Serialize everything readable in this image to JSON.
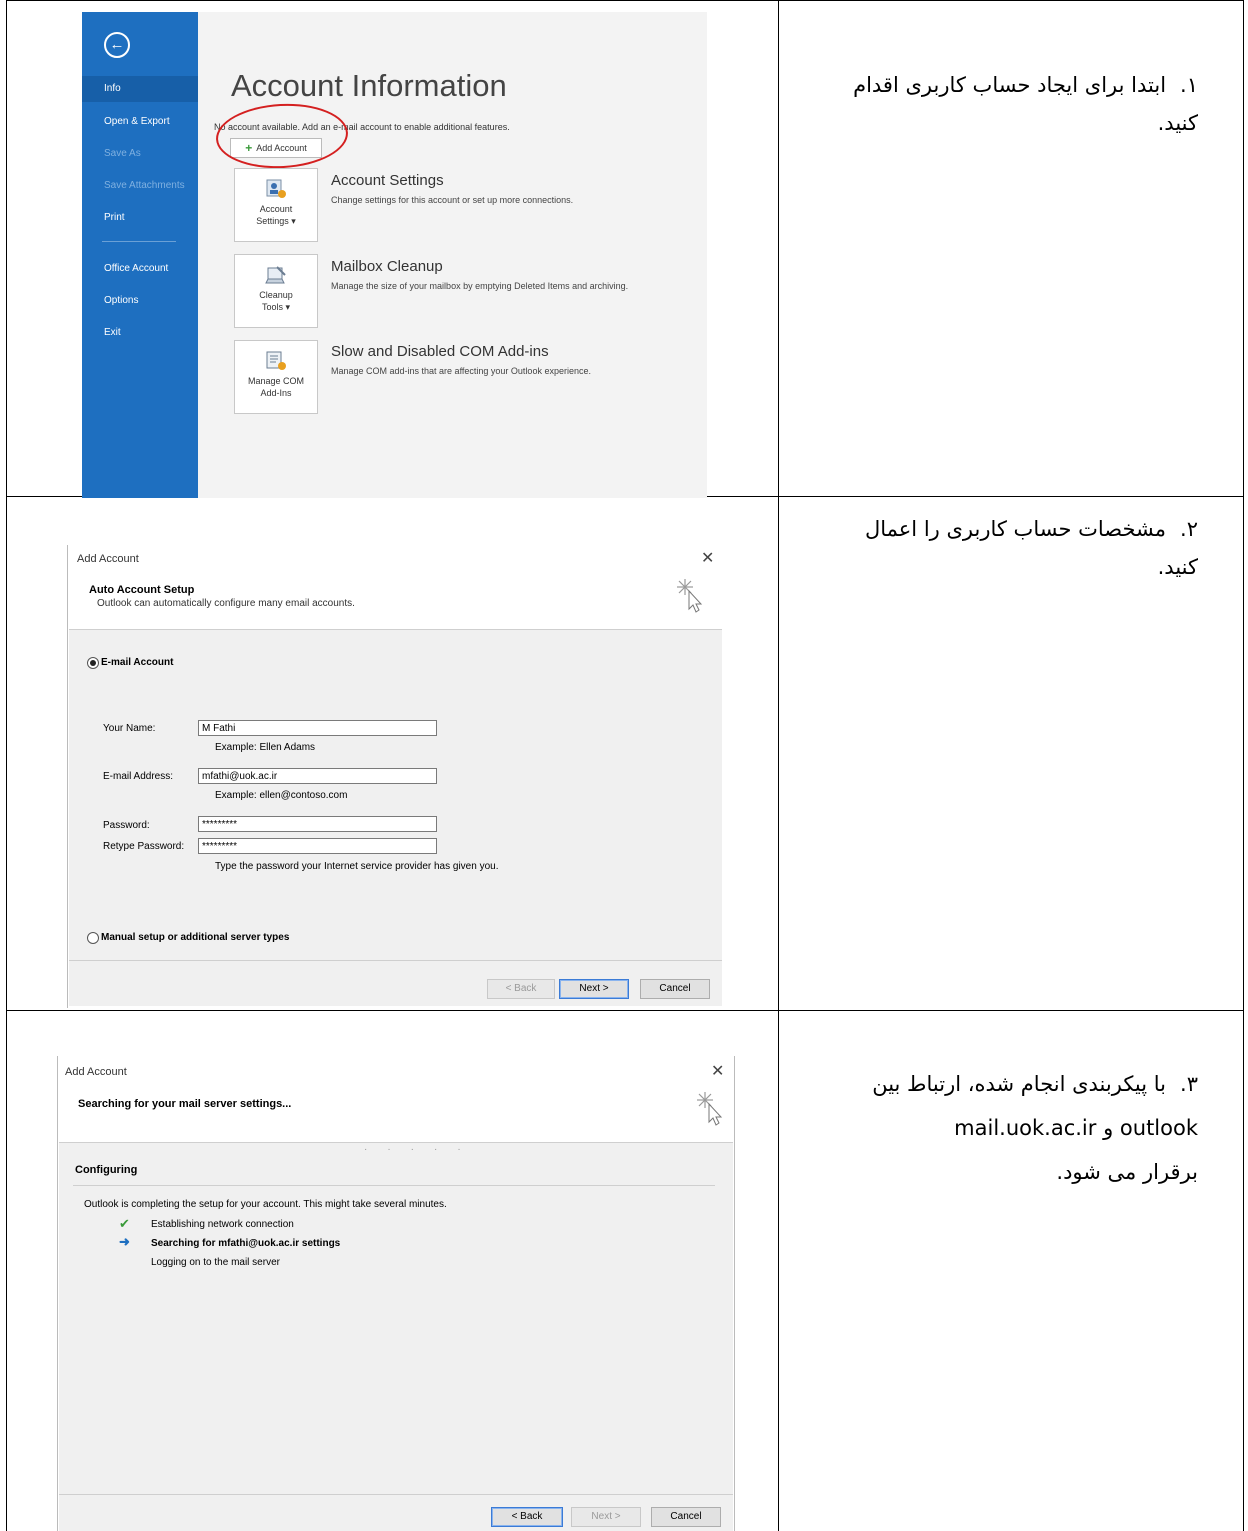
{
  "steps": [
    {
      "number": "۱.",
      "text_line1": "ابتدا برای ایجاد حساب کاربری اقدام",
      "text_line2": "کنید."
    },
    {
      "number": "۲.",
      "text_line1": "مشخصات حساب کاربری را اعمال",
      "text_line2": "کنید."
    },
    {
      "number": "۳.",
      "text_line1": "با پیکربندی انجام شده، ارتباط بین",
      "text_line2": "outlook و mail.uok.ac.ir",
      "text_line3": "برقرار می شود."
    }
  ],
  "backstage": {
    "back_icon": "back-arrow-icon",
    "sidebar": {
      "info": "Info",
      "open_export": "Open & Export",
      "save_as": "Save As",
      "save_attachments": "Save Attachments",
      "print": "Print",
      "office_account": "Office Account",
      "options": "Options",
      "exit": "Exit"
    },
    "title": "Account Information",
    "no_account_text": "No account available. Add an e-mail account to enable additional features.",
    "add_account_label": "Add Account",
    "sections": [
      {
        "tile_label_1": "Account",
        "tile_label_2": "Settings ▾",
        "title": "Account Settings",
        "desc": "Change settings for this account or set up more connections.",
        "icon": "account-settings-icon"
      },
      {
        "tile_label_1": "Cleanup",
        "tile_label_2": "Tools ▾",
        "title": "Mailbox Cleanup",
        "desc": "Manage the size of your mailbox by emptying Deleted Items and archiving.",
        "icon": "cleanup-tools-icon"
      },
      {
        "tile_label_1": "Manage COM",
        "tile_label_2": "Add-Ins",
        "title": "Slow and Disabled COM Add-ins",
        "desc": "Manage COM add-ins that are affecting your Outlook experience.",
        "icon": "com-addins-icon"
      }
    ],
    "colors": {
      "sidebar": "#1e6fc0",
      "highlight_circle": "#d42020"
    }
  },
  "dialog_setup": {
    "title": "Add Account",
    "heading": "Auto Account Setup",
    "subheading": "Outlook can automatically configure many email accounts.",
    "email_account_label": "E-mail Account",
    "name_label": "Your Name:",
    "name_value": "M Fathi",
    "name_example": "Example: Ellen Adams",
    "email_label": "E-mail Address:",
    "email_value": "mfathi@uok.ac.ir",
    "email_example": "Example: ellen@contoso.com",
    "password_label": "Password:",
    "password_value": "*********",
    "retype_label": "Retype Password:",
    "retype_value": "*********",
    "password_hint": "Type the password your Internet service provider has given you.",
    "manual_label": "Manual setup or additional server types",
    "back_label": "< Back",
    "next_label": "Next >",
    "cancel_label": "Cancel"
  },
  "dialog_searching": {
    "title": "Add Account",
    "heading": "Searching for your mail server settings...",
    "configuring": "Configuring",
    "message": "Outlook is completing the setup for your account. This might take several minutes.",
    "statuses": [
      {
        "icon": "checkmark-icon",
        "text": "Establishing network connection",
        "bold": false
      },
      {
        "icon": "arrow-right-icon",
        "text": "Searching for mfathi@uok.ac.ir settings",
        "bold": true
      },
      {
        "icon": "",
        "text": "Logging on to the mail server",
        "bold": false
      }
    ],
    "back_label": "< Back",
    "next_label": "Next >",
    "cancel_label": "Cancel"
  }
}
